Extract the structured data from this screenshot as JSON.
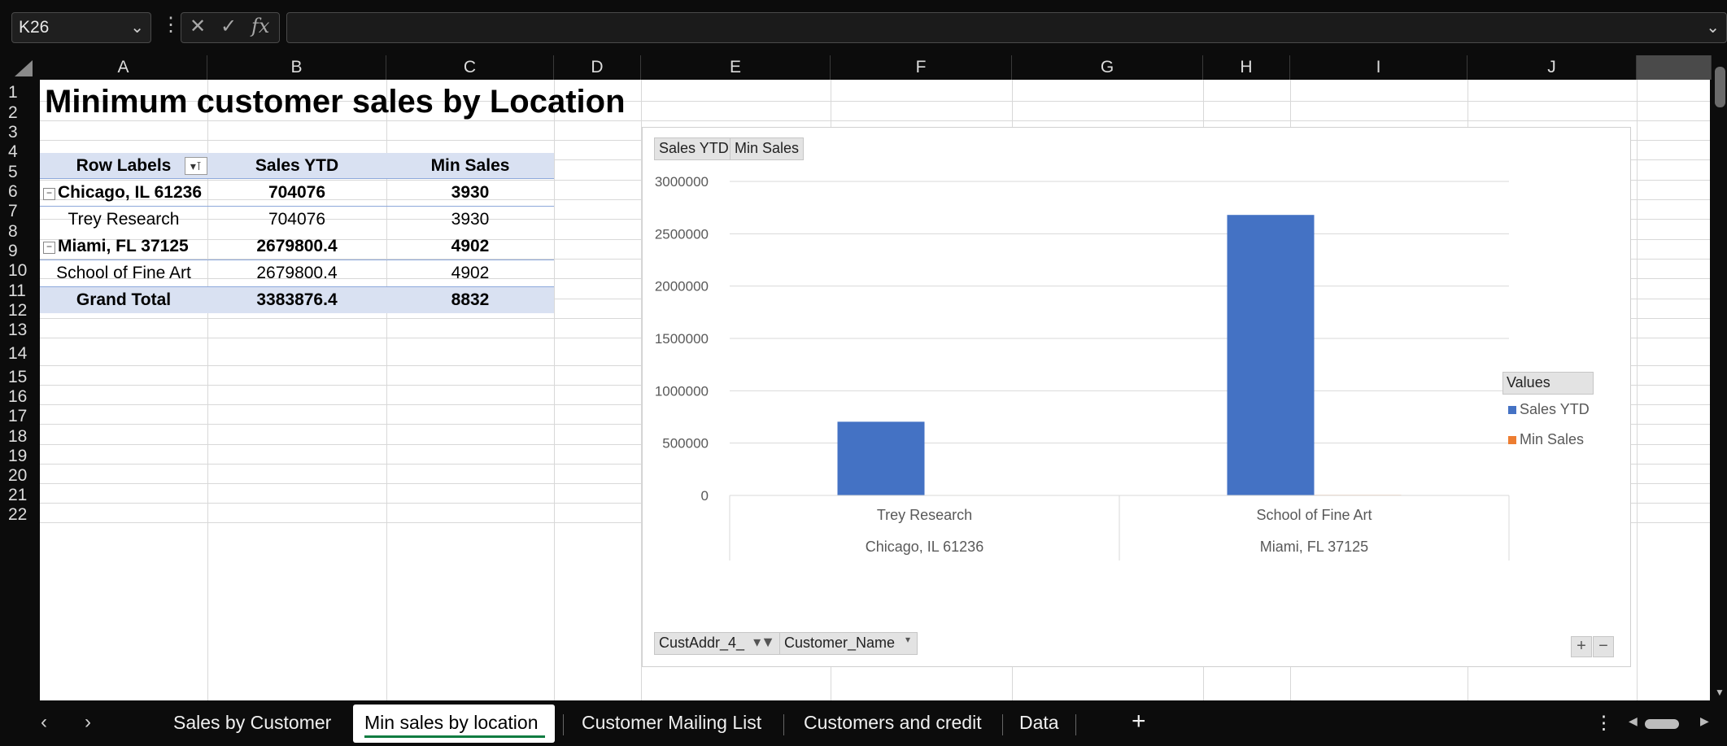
{
  "name_box": "K26",
  "formula_bar": {
    "cancel_glyph": "✕",
    "enter_glyph": "✓",
    "fx_label": "fx",
    "value": ""
  },
  "columns": [
    "A",
    "B",
    "C",
    "D",
    "E",
    "F",
    "G",
    "H",
    "I",
    "J"
  ],
  "rows": [
    "1",
    "2",
    "3",
    "4",
    "5",
    "6",
    "7",
    "8",
    "9",
    "10",
    "11",
    "12",
    "13",
    "14",
    "15",
    "16",
    "17",
    "18",
    "19",
    "20",
    "21",
    "22"
  ],
  "sheet": {
    "title": "Minimum customer sales by Location",
    "pivot": {
      "headers": [
        "Row Labels",
        "Sales YTD",
        "Min Sales"
      ],
      "rows": [
        {
          "label": "Chicago, IL 61236",
          "sales": "704076",
          "min": "3930",
          "bold": true
        },
        {
          "label": "Trey Research",
          "sales": "704076",
          "min": "3930",
          "bold": false
        },
        {
          "label": "Miami, FL 37125",
          "sales": "2679800.4",
          "min": "4902",
          "bold": true
        },
        {
          "label": "School of Fine Art",
          "sales": "2679800.4",
          "min": "4902",
          "bold": false
        }
      ],
      "total": {
        "label": "Grand Total",
        "sales": "3383876.4",
        "min": "8832"
      }
    }
  },
  "chart": {
    "value_buttons": [
      "Sales YTD",
      "Min Sales"
    ],
    "axis_buttons": [
      "CustAddr_4_",
      "Customer_Name"
    ],
    "legend_title": "Values",
    "plus": "+",
    "minus": "−"
  },
  "chart_data": {
    "type": "bar",
    "categories": [
      "Trey Research",
      "School of Fine Art"
    ],
    "group_labels": [
      "Chicago, IL 61236",
      "Miami, FL 37125"
    ],
    "series": [
      {
        "name": "Sales YTD",
        "values": [
          704076,
          2679800.4
        ],
        "color": "#4472c4"
      },
      {
        "name": "Min Sales",
        "values": [
          3930,
          4902
        ],
        "color": "#ed7d31"
      }
    ],
    "yticks": [
      "0",
      "500000",
      "1000000",
      "1500000",
      "2000000",
      "2500000",
      "3000000"
    ],
    "ylim": [
      0,
      3000000
    ],
    "legend": "right",
    "grid": true
  },
  "tabs": [
    "Sales by Customer",
    "Min sales by location",
    "Customer Mailing List",
    "Customers and credit",
    "Data"
  ],
  "active_tab_index": 1,
  "tabbar_icons": {
    "prev": "‹",
    "next": "›",
    "add": "+",
    "more": "⋮"
  }
}
